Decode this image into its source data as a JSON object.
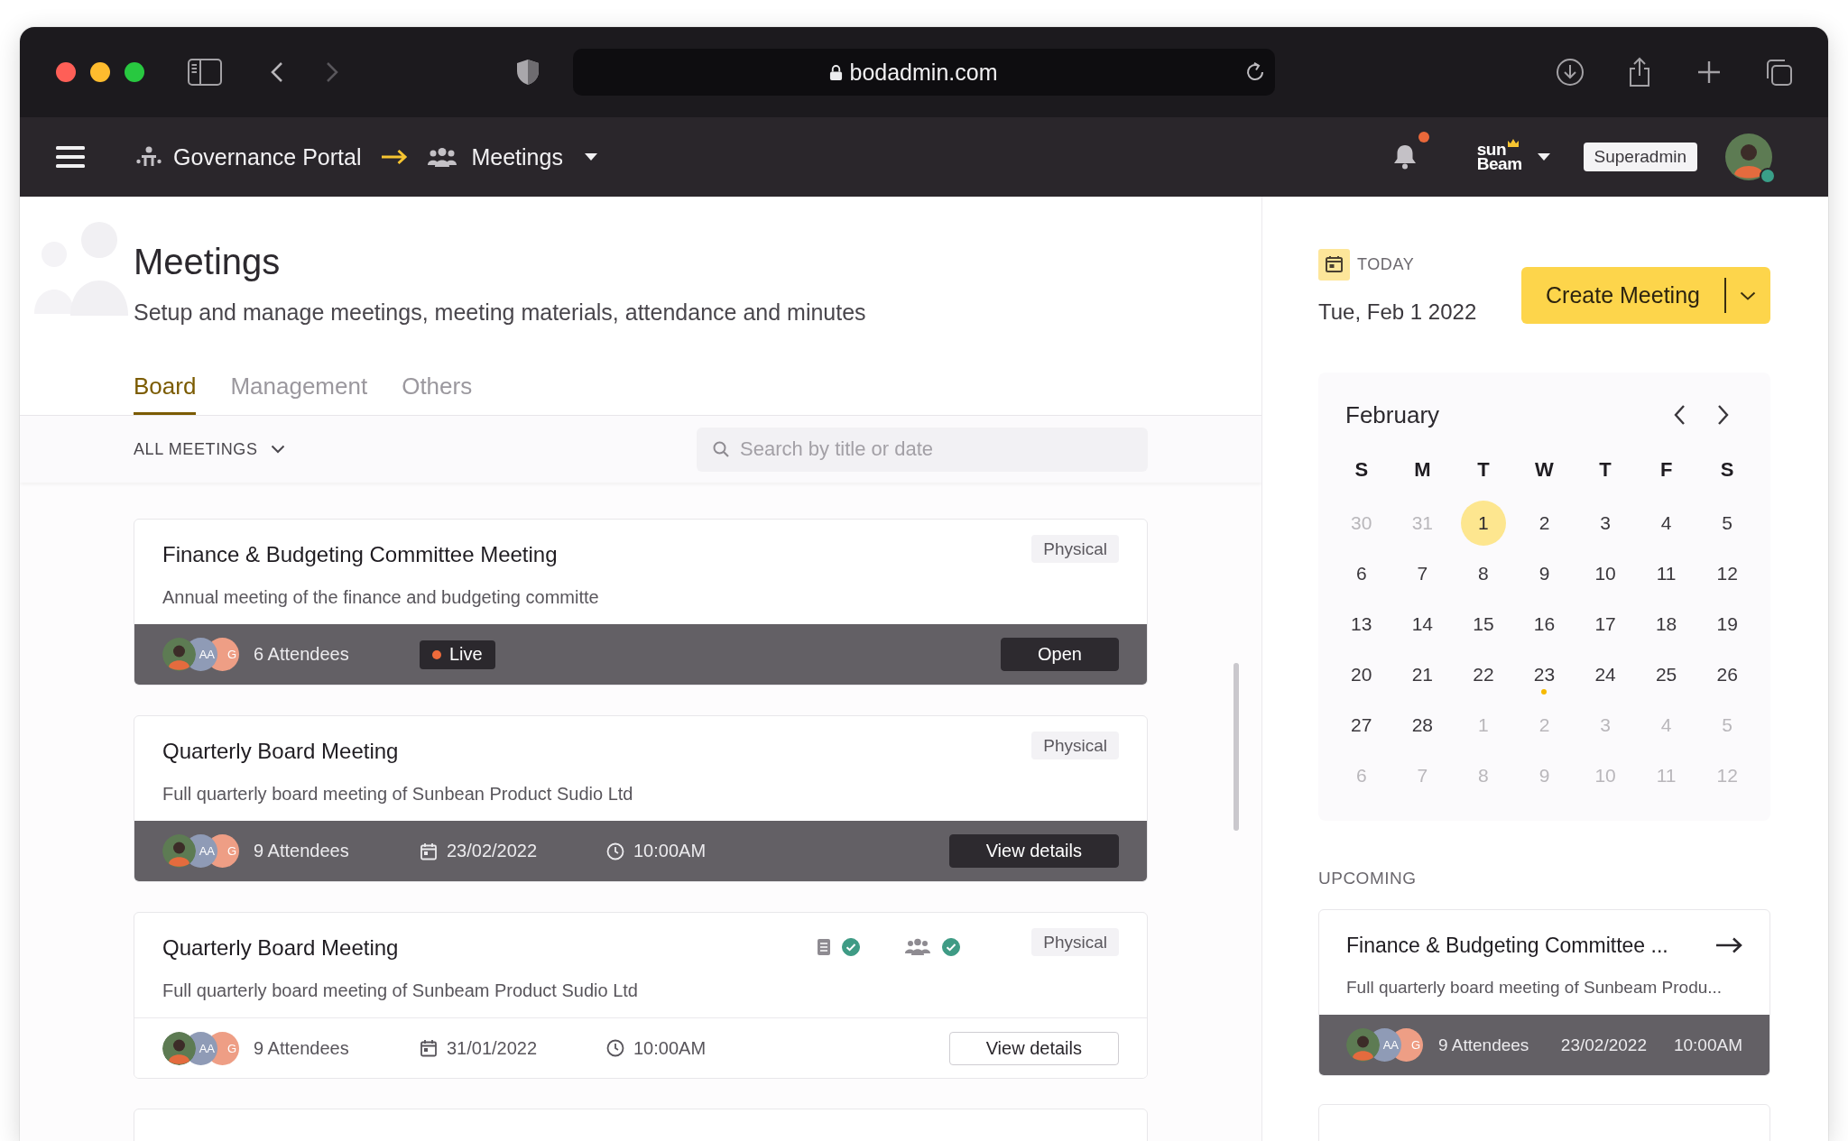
{
  "browser": {
    "url": "bodadmin.com",
    "back_enabled": true,
    "forward_enabled": false
  },
  "navbar": {
    "breadcrumb": [
      {
        "kind": "portal",
        "label": "Governance Portal",
        "dropdown": false
      },
      {
        "kind": "meetings",
        "label": "Meetings",
        "dropdown": true
      }
    ],
    "notifications_unread": true,
    "brand_logo": [
      "sun",
      "Beam"
    ],
    "role": "Superadmin",
    "user": {
      "online": true
    }
  },
  "page": {
    "title": "Meetings",
    "subtitle": "Setup and manage meetings, meeting materials, attendance and minutes"
  },
  "tabs": [
    {
      "label": "Board",
      "selected": true
    },
    {
      "label": "Management",
      "selected": false
    },
    {
      "label": "Others",
      "selected": false
    }
  ],
  "filter": {
    "label": "ALL MEETINGS"
  },
  "search": {
    "placeholder": "Search by title or date"
  },
  "meetings": [
    {
      "title": "Finance & Budgeting Committee Meeting",
      "description": "Annual meeting of the finance and budgeting committe",
      "tag": "Physical",
      "highlighted": true,
      "avatars": [
        {
          "kind": "photo"
        },
        {
          "kind": "initials",
          "text": "AA",
          "color": "#8f9bb6"
        },
        {
          "kind": "initials",
          "text": "G",
          "color": "#ee9e85"
        }
      ],
      "attendees": "6 Attendees",
      "status": {
        "kind": "live",
        "label": "Live"
      },
      "action": "Open"
    },
    {
      "title": "Quarterly Board Meeting",
      "description": "Full quarterly board meeting of Sunbean Product Sudio Ltd",
      "tag": "Physical",
      "highlighted": true,
      "avatars": [
        {
          "kind": "photo"
        },
        {
          "kind": "initials",
          "text": "AA",
          "color": "#8f9bb6"
        },
        {
          "kind": "initials",
          "text": "G",
          "color": "#ee9e85"
        }
      ],
      "attendees": "9 Attendees",
      "date": "23/02/2022",
      "time": "10:00AM",
      "action": "View details"
    },
    {
      "title": "Quarterly Board Meeting",
      "description": "Full quarterly board meeting of Sunbeam Product Sudio Ltd",
      "tag": "Physical",
      "checks": [
        {
          "kind": "document",
          "done": true
        },
        {
          "kind": "attendance",
          "done": true
        }
      ],
      "highlighted": false,
      "avatars": [
        {
          "kind": "photo"
        },
        {
          "kind": "initials",
          "text": "AA",
          "color": "#8f9bb6"
        },
        {
          "kind": "initials",
          "text": "G",
          "color": "#ee9e85"
        }
      ],
      "attendees": "9 Attendees",
      "date": "31/01/2022",
      "time": "10:00AM",
      "action": "View details"
    }
  ],
  "today": {
    "label": "TODAY",
    "date": "Tue, Feb 1 2022"
  },
  "create_button": {
    "label": "Create Meeting"
  },
  "calendar": {
    "month": "February",
    "weekdays": [
      "S",
      "M",
      "T",
      "W",
      "T",
      "F",
      "S"
    ],
    "weeks": [
      [
        {
          "label": "30",
          "in_month": false,
          "selected": false,
          "event": false
        },
        {
          "label": "31",
          "in_month": false,
          "selected": false,
          "event": false
        },
        {
          "label": "1",
          "in_month": true,
          "selected": true,
          "event": false
        },
        {
          "label": "2",
          "in_month": true,
          "selected": false,
          "event": false
        },
        {
          "label": "3",
          "in_month": true,
          "selected": false,
          "event": false
        },
        {
          "label": "4",
          "in_month": true,
          "selected": false,
          "event": false
        },
        {
          "label": "5",
          "in_month": true,
          "selected": false,
          "event": false
        }
      ],
      [
        {
          "label": "6",
          "in_month": true,
          "selected": false,
          "event": false
        },
        {
          "label": "7",
          "in_month": true,
          "selected": false,
          "event": false
        },
        {
          "label": "8",
          "in_month": true,
          "selected": false,
          "event": false
        },
        {
          "label": "9",
          "in_month": true,
          "selected": false,
          "event": false
        },
        {
          "label": "10",
          "in_month": true,
          "selected": false,
          "event": false
        },
        {
          "label": "11",
          "in_month": true,
          "selected": false,
          "event": false
        },
        {
          "label": "12",
          "in_month": true,
          "selected": false,
          "event": false
        }
      ],
      [
        {
          "label": "13",
          "in_month": true,
          "selected": false,
          "event": false
        },
        {
          "label": "14",
          "in_month": true,
          "selected": false,
          "event": false
        },
        {
          "label": "15",
          "in_month": true,
          "selected": false,
          "event": false
        },
        {
          "label": "16",
          "in_month": true,
          "selected": false,
          "event": false
        },
        {
          "label": "17",
          "in_month": true,
          "selected": false,
          "event": false
        },
        {
          "label": "18",
          "in_month": true,
          "selected": false,
          "event": false
        },
        {
          "label": "19",
          "in_month": true,
          "selected": false,
          "event": false
        }
      ],
      [
        {
          "label": "20",
          "in_month": true,
          "selected": false,
          "event": false
        },
        {
          "label": "21",
          "in_month": true,
          "selected": false,
          "event": false
        },
        {
          "label": "22",
          "in_month": true,
          "selected": false,
          "event": false
        },
        {
          "label": "23",
          "in_month": true,
          "selected": false,
          "event": true
        },
        {
          "label": "24",
          "in_month": true,
          "selected": false,
          "event": false
        },
        {
          "label": "25",
          "in_month": true,
          "selected": false,
          "event": false
        },
        {
          "label": "26",
          "in_month": true,
          "selected": false,
          "event": false
        }
      ],
      [
        {
          "label": "27",
          "in_month": true,
          "selected": false,
          "event": false
        },
        {
          "label": "28",
          "in_month": true,
          "selected": false,
          "event": false
        },
        {
          "label": "1",
          "in_month": false,
          "selected": false,
          "event": false
        },
        {
          "label": "2",
          "in_month": false,
          "selected": false,
          "event": false
        },
        {
          "label": "3",
          "in_month": false,
          "selected": false,
          "event": false
        },
        {
          "label": "4",
          "in_month": false,
          "selected": false,
          "event": false
        },
        {
          "label": "5",
          "in_month": false,
          "selected": false,
          "event": false
        }
      ],
      [
        {
          "label": "6",
          "in_month": false,
          "selected": false,
          "event": false
        },
        {
          "label": "7",
          "in_month": false,
          "selected": false,
          "event": false
        },
        {
          "label": "8",
          "in_month": false,
          "selected": false,
          "event": false
        },
        {
          "label": "9",
          "in_month": false,
          "selected": false,
          "event": false
        },
        {
          "label": "10",
          "in_month": false,
          "selected": false,
          "event": false
        },
        {
          "label": "11",
          "in_month": false,
          "selected": false,
          "event": false
        },
        {
          "label": "12",
          "in_month": false,
          "selected": false,
          "event": false
        }
      ]
    ]
  },
  "upcoming": {
    "label": "UPCOMING",
    "items": [
      {
        "title": "Finance & Budgeting Committee ...",
        "description": "Full quarterly board meeting of Sunbeam Produ...",
        "highlighted": true,
        "avatars": [
          {
            "kind": "photo"
          },
          {
            "kind": "initials",
            "text": "AA",
            "color": "#8f9bb6"
          },
          {
            "kind": "initials",
            "text": "G",
            "color": "#ee9e85"
          }
        ],
        "attendees": "9 Attendees",
        "date": "23/02/2022",
        "time": "10:00AM"
      }
    ]
  }
}
